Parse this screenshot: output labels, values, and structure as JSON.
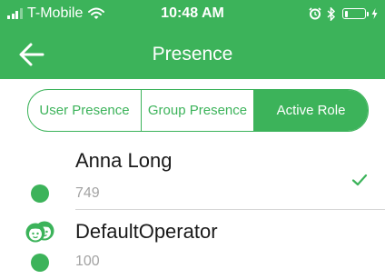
{
  "status_bar": {
    "carrier": "T-Mobile",
    "time": "10:48 AM",
    "battery_level": 0.15
  },
  "nav": {
    "title": "Presence"
  },
  "tabs": [
    {
      "label": "User Presence",
      "active": false
    },
    {
      "label": "Group Presence",
      "active": false
    },
    {
      "label": "Active Role",
      "active": true
    }
  ],
  "roles": [
    {
      "name": "Anna Long",
      "number": "749",
      "selected": true,
      "status_color": "#3cb35a",
      "icon": "none"
    },
    {
      "name": "DefaultOperator",
      "number": "100",
      "selected": false,
      "status_color": "#3cb35a",
      "icon": "group-icon"
    }
  ],
  "colors": {
    "accent": "#3cb35a",
    "text": "#1a1a1a",
    "secondary_text": "#a3a3a3"
  }
}
